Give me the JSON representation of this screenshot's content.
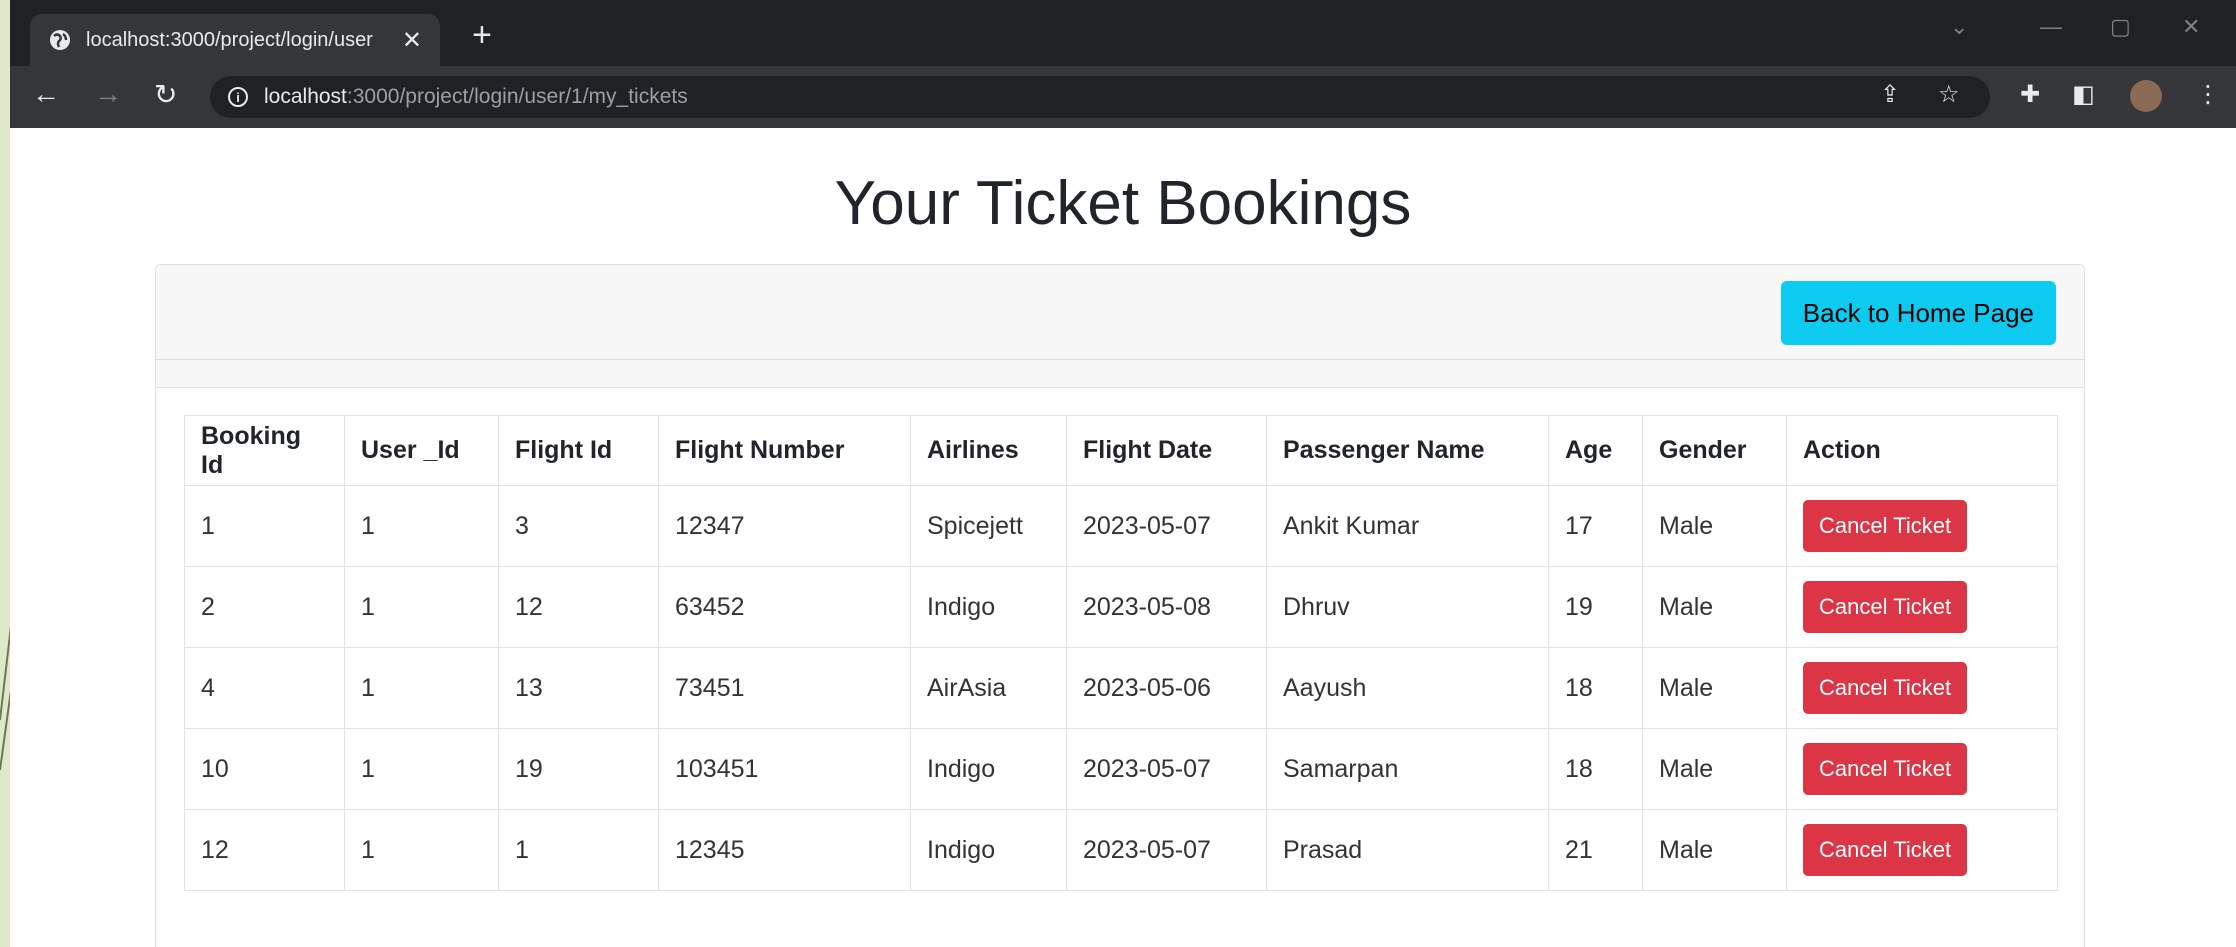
{
  "browser": {
    "tab_title": "localhost:3000/project/login/user",
    "url_host": "localhost",
    "url_rest": ":3000/project/login/user/1/my_tickets"
  },
  "page": {
    "title": "Your Ticket Bookings",
    "back_button": "Back to Home Page",
    "columns": [
      "Booking Id",
      "User _Id",
      "Flight Id",
      "Flight Number",
      "Airlines",
      "Flight Date",
      "Passenger Name",
      "Age",
      "Gender",
      "Action"
    ],
    "rows": [
      {
        "booking_id": "1",
        "user_id": "1",
        "flight_id": "3",
        "flight_number": "12347",
        "airline": "Spicejett",
        "date": "2023-05-07",
        "passenger": "Ankit Kumar",
        "age": "17",
        "gender": "Male",
        "action": "Cancel Ticket"
      },
      {
        "booking_id": "2",
        "user_id": "1",
        "flight_id": "12",
        "flight_number": "63452",
        "airline": "Indigo",
        "date": "2023-05-08",
        "passenger": "Dhruv",
        "age": "19",
        "gender": "Male",
        "action": "Cancel Ticket"
      },
      {
        "booking_id": "4",
        "user_id": "1",
        "flight_id": "13",
        "flight_number": "73451",
        "airline": "AirAsia",
        "date": "2023-05-06",
        "passenger": "Aayush",
        "age": "18",
        "gender": "Male",
        "action": "Cancel Ticket"
      },
      {
        "booking_id": "10",
        "user_id": "1",
        "flight_id": "19",
        "flight_number": "103451",
        "airline": "Indigo",
        "date": "2023-05-07",
        "passenger": "Samarpan",
        "age": "18",
        "gender": "Male",
        "action": "Cancel Ticket"
      },
      {
        "booking_id": "12",
        "user_id": "1",
        "flight_id": "1",
        "flight_number": "12345",
        "airline": "Indigo",
        "date": "2023-05-07",
        "passenger": "Prasad",
        "age": "21",
        "gender": "Male",
        "action": "Cancel Ticket"
      }
    ]
  },
  "colors": {
    "info_button": "#0dcaf0",
    "danger_button": "#dc3545",
    "chrome_dark": "#202124"
  }
}
